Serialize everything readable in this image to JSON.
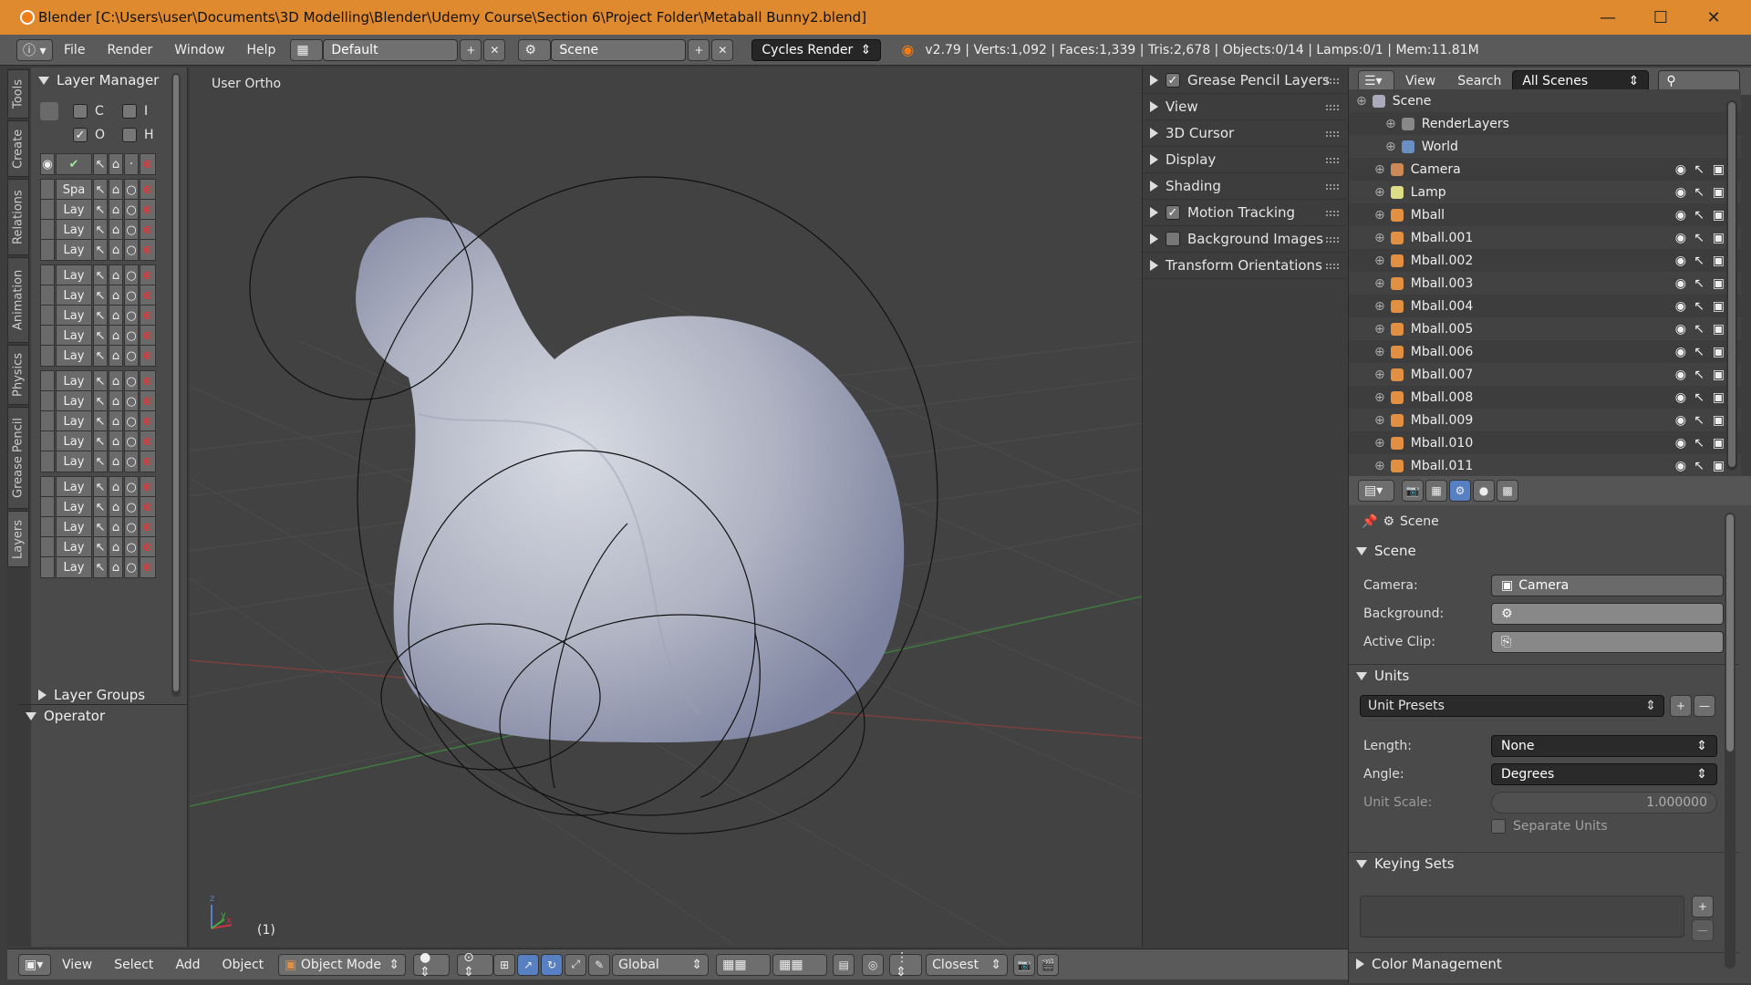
{
  "window": {
    "title": "Blender  [C:\\Users\\user\\Documents\\3D Modelling\\Blender\\Udemy Course\\Section 6\\Project Folder\\Metaball Bunny2.blend]",
    "min": "—",
    "max": "☐",
    "close": "✕"
  },
  "infobar": {
    "menus": [
      "File",
      "Render",
      "Window",
      "Help"
    ],
    "layout": "Default",
    "scene": "Scene",
    "engine": "Cycles Render",
    "stats": "v2.79 | Verts:1,092 | Faces:1,339 | Tris:2,678 | Objects:0/14 | Lamps:0/1 | Mem:11.81M"
  },
  "lefttabs": [
    "Tools",
    "Create",
    "Relations",
    "Animation",
    "Physics",
    "Grease Pencil",
    "Layers"
  ],
  "layer_panel": {
    "title": "Layer Manager",
    "filters": [
      "C",
      "I",
      "O",
      "H"
    ],
    "first_layer": "",
    "spa": "Spa",
    "lay": "Lay",
    "groups": "Layer Groups",
    "operator": "Operator"
  },
  "viewport": {
    "label": "User Ortho",
    "frame": "(1)",
    "axis_x": "x",
    "axis_y": "y",
    "axis_z": "z"
  },
  "npanel": {
    "sections": [
      {
        "label": "Grease Pencil Layers",
        "checkbox": true,
        "checked": true
      },
      {
        "label": "View",
        "checkbox": false
      },
      {
        "label": "3D Cursor",
        "checkbox": false
      },
      {
        "label": "Display",
        "checkbox": false
      },
      {
        "label": "Shading",
        "checkbox": false
      },
      {
        "label": "Motion Tracking",
        "checkbox": true,
        "checked": true
      },
      {
        "label": "Background Images",
        "checkbox": true,
        "checked": false
      },
      {
        "label": "Transform Orientations",
        "checkbox": false
      }
    ]
  },
  "outliner": {
    "view": "View",
    "search": "Search",
    "filter": "All Scenes",
    "rows": [
      "Scene",
      "RenderLayers",
      "World",
      "Camera",
      "Lamp",
      "Mball",
      "Mball.001",
      "Mball.002",
      "Mball.003",
      "Mball.004",
      "Mball.005",
      "Mball.006",
      "Mball.007",
      "Mball.008",
      "Mball.009",
      "Mball.010",
      "Mball.011"
    ]
  },
  "properties": {
    "breadcrumb": "Scene",
    "scene_header": "Scene",
    "camera_label": "Camera:",
    "camera_value": "Camera",
    "background_label": "Background:",
    "clip_label": "Active Clip:",
    "units_header": "Units",
    "unit_presets": "Unit Presets",
    "length_label": "Length:",
    "length_value": "None",
    "angle_label": "Angle:",
    "angle_value": "Degrees",
    "scale_label": "Unit Scale:",
    "scale_value": "1.000000",
    "separate_units": "Separate Units",
    "keying_sets": "Keying Sets",
    "color_mgmt": "Color Management"
  },
  "bottombar": {
    "menus": [
      "View",
      "Select",
      "Add",
      "Object"
    ],
    "mode": "Object Mode",
    "orientation": "Global",
    "snap": "Closest"
  },
  "colors": {
    "titlebar": "#e08a30",
    "panel": "#4a4a4a",
    "viewport": "#424242",
    "accent_blue": "#5680c2"
  }
}
